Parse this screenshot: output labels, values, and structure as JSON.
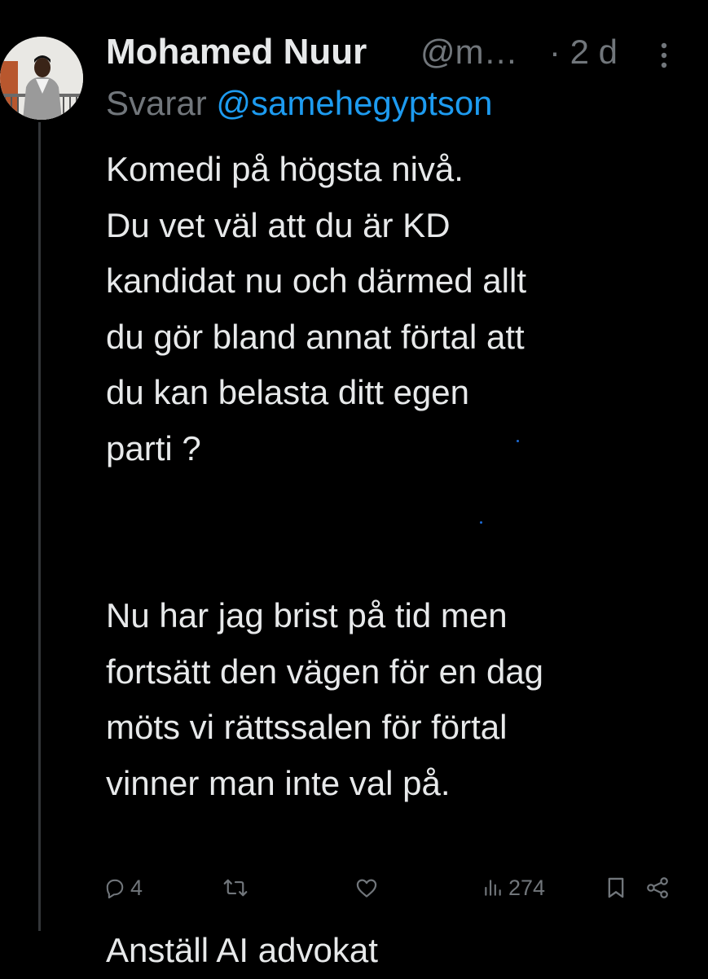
{
  "tweet": {
    "author": {
      "display_name": "Mohamed Nuur",
      "handle": "@m…",
      "avatar_icon": "avatar-photo"
    },
    "timestamp": "· 2 d",
    "reply_prefix": "Svarar",
    "reply_to": "@samehegyptson",
    "body": {
      "paragraph_1": [
        "Komedi på högsta nivå.",
        "Du vet väl att du är KD",
        "kandidat nu och därmed allt",
        "du gör bland annat förtal att",
        "du kan belasta ditt egen",
        "parti ?"
      ],
      "paragraph_2": [
        "Nu har jag brist på tid men",
        "fortsätt den vägen för en dag",
        "möts vi rättssalen för förtal",
        "vinner man inte val på."
      ],
      "paragraph_3": [
        "Anställ AI advokat"
      ]
    },
    "actions": {
      "reply_count": "4",
      "retweet_count": "",
      "like_count": "",
      "views_count": "274"
    }
  },
  "colors": {
    "background": "#000000",
    "text_primary": "#e7e9ea",
    "text_secondary": "#71767b",
    "accent": "#1d9bf0",
    "thread_line": "#333639"
  }
}
